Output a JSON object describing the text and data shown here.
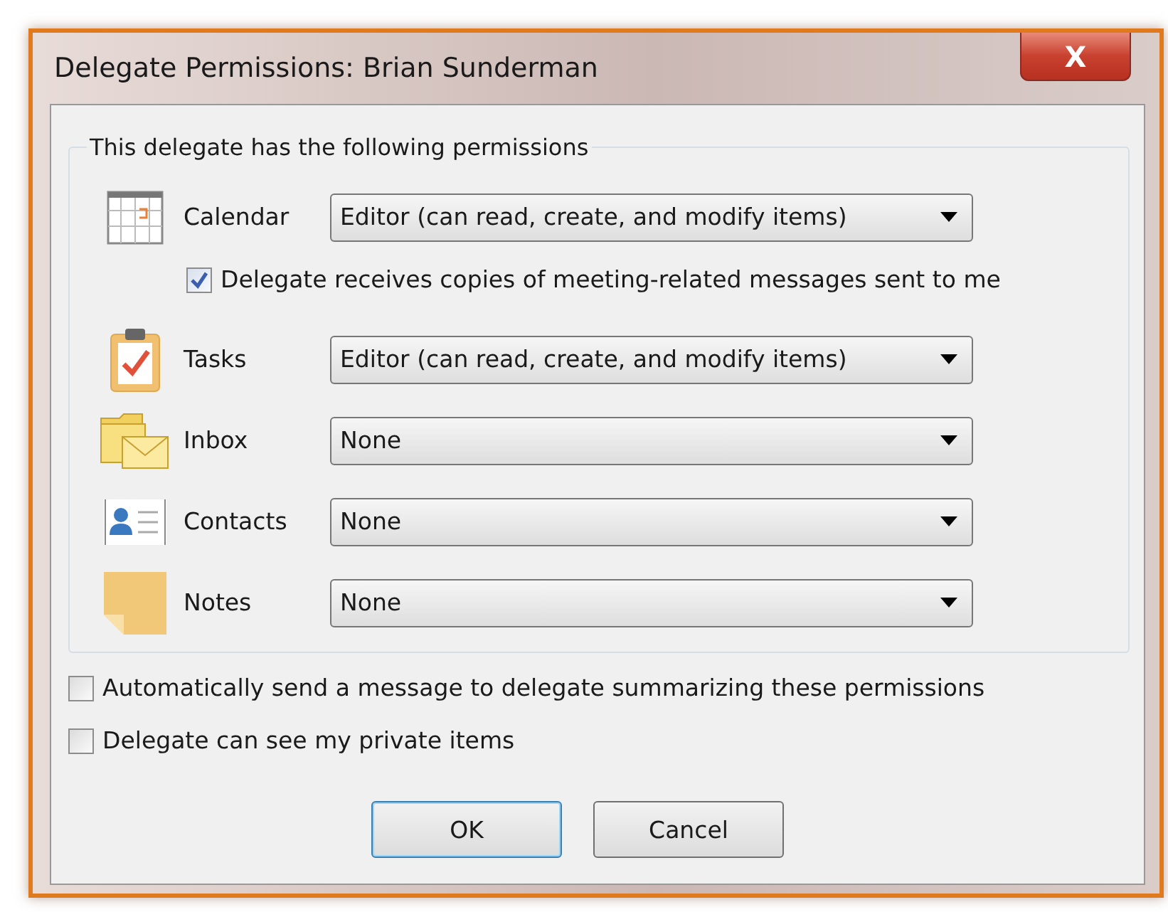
{
  "window": {
    "title": "Delegate Permissions: Brian Sunderman",
    "close_label": "X"
  },
  "permissions": {
    "legend": "This delegate has the following permissions",
    "items": [
      {
        "label": "Calendar",
        "value": "Editor (can read, create, and modify items)",
        "option": {
          "label": "Delegate receives copies of meeting-related messages sent to me",
          "checked": true
        }
      },
      {
        "label": "Tasks",
        "value": "Editor (can read, create, and modify items)"
      },
      {
        "label": "Inbox",
        "value": "None"
      },
      {
        "label": "Contacts",
        "value": "None"
      },
      {
        "label": "Notes",
        "value": "None"
      }
    ]
  },
  "options": [
    {
      "label": "Automatically send a message to delegate summarizing these permissions",
      "checked": false
    },
    {
      "label": "Delegate can see my private items",
      "checked": false
    }
  ],
  "buttons": [
    {
      "label": "OK",
      "default": true
    },
    {
      "label": "Cancel",
      "default": false
    }
  ]
}
